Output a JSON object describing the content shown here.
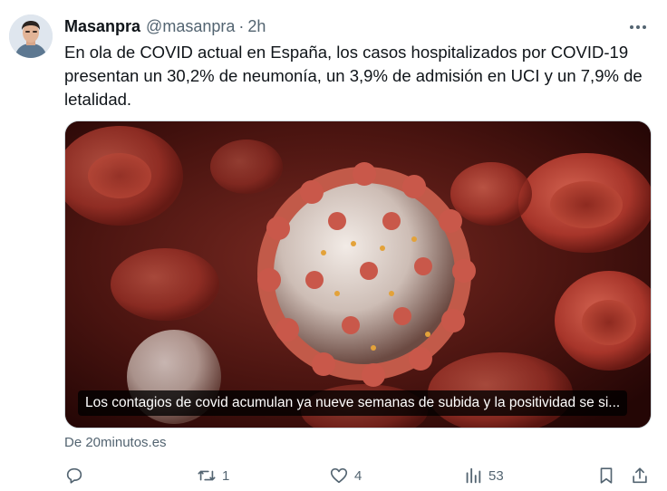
{
  "tweet": {
    "author_name": "Masanpra",
    "author_handle": "@masanpra",
    "separator": "·",
    "time": "2h",
    "text": "En ola de COVID actual en España, los casos hospitalizados por COVID-19 presentan un 30,2% de neumonía, un 3,9% de admisión en UCI y un 7,9% de letalidad.",
    "more_icon": "ellipsis-icon"
  },
  "media": {
    "caption": "Los contagios de covid acumulan ya nueve semanas de subida y la positividad se si...",
    "source": "De 20minutos.es"
  },
  "actions": {
    "reply": {
      "icon": "reply-icon",
      "count": ""
    },
    "retweet": {
      "icon": "retweet-icon",
      "count": "1"
    },
    "like": {
      "icon": "heart-icon",
      "count": "4"
    },
    "views": {
      "icon": "views-icon",
      "count": "53"
    },
    "bookmark": {
      "icon": "bookmark-icon"
    },
    "share": {
      "icon": "share-icon"
    }
  },
  "colors": {
    "text_primary": "#0f1419",
    "text_secondary": "#536471",
    "border": "#cfd9de"
  }
}
